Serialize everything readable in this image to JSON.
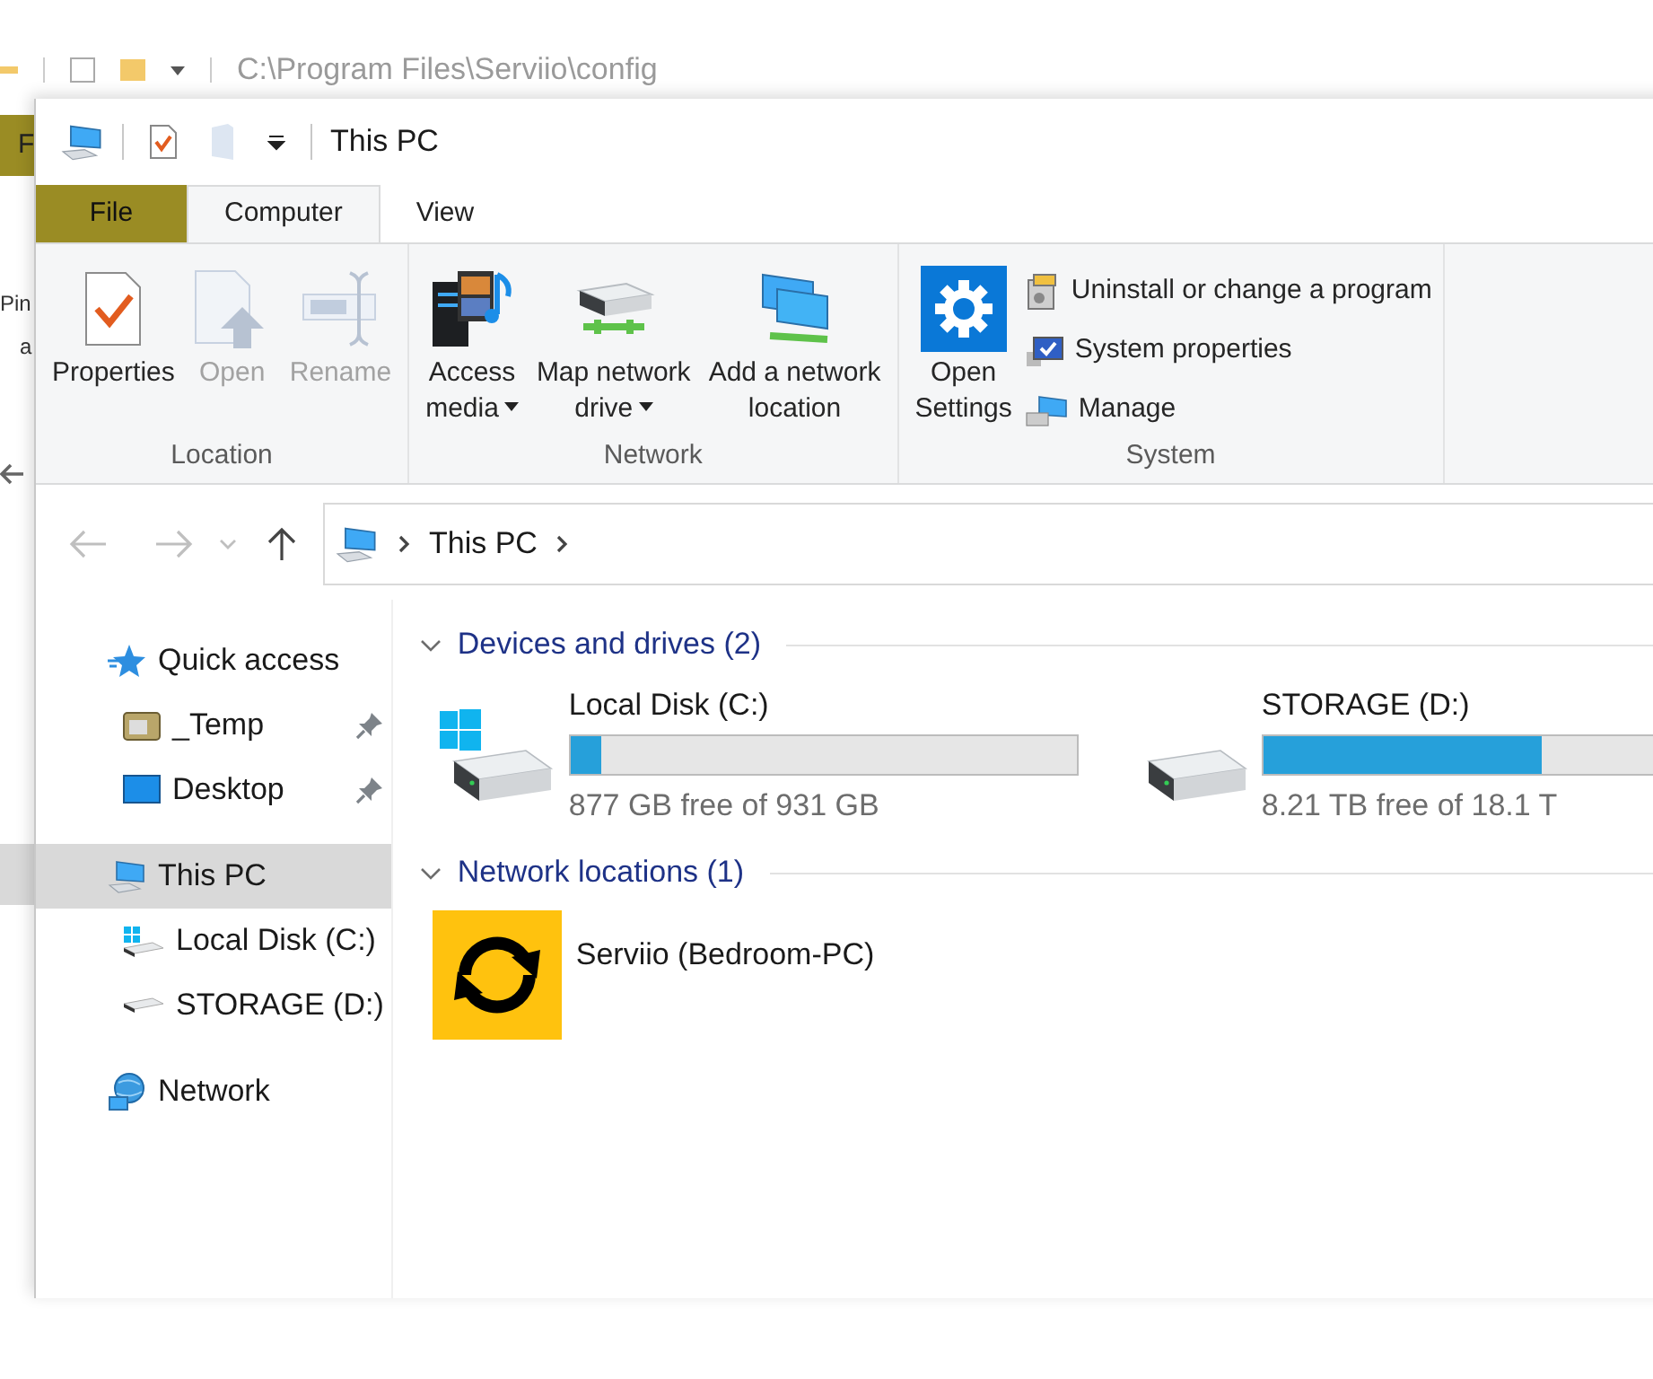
{
  "background_window": {
    "path": "C:\\Program Files\\Serviio\\config",
    "file_tab": "F",
    "labels": [
      "Pin",
      "a"
    ]
  },
  "window": {
    "title": "This PC"
  },
  "ribbon": {
    "file_menu": "File",
    "tabs": [
      {
        "label": "Computer",
        "selected": true
      },
      {
        "label": "View",
        "selected": false
      }
    ],
    "groups": [
      {
        "name": "Location",
        "buttons": [
          {
            "kind": "properties",
            "lines": [
              "Properties"
            ],
            "disabled": false,
            "has_menu": false
          },
          {
            "kind": "open",
            "lines": [
              "Open"
            ],
            "disabled": true,
            "has_menu": false
          },
          {
            "kind": "rename",
            "lines": [
              "Rename"
            ],
            "disabled": true,
            "has_menu": false
          }
        ]
      },
      {
        "name": "Network",
        "buttons": [
          {
            "kind": "media",
            "lines": [
              "Access",
              "media"
            ],
            "disabled": false,
            "has_menu": true
          },
          {
            "kind": "map_drive",
            "lines": [
              "Map network",
              "drive"
            ],
            "disabled": false,
            "has_menu": true
          },
          {
            "kind": "add_location",
            "lines": [
              "Add a network",
              "location"
            ],
            "disabled": false,
            "has_menu": false
          }
        ]
      },
      {
        "name": "System",
        "buttons": [
          {
            "kind": "settings",
            "lines": [
              "Open",
              "Settings"
            ],
            "disabled": false,
            "has_menu": false
          }
        ],
        "commands": [
          {
            "kind": "uninstall",
            "label": "Uninstall or change a program",
            "disabled": false
          },
          {
            "kind": "system_properties",
            "label": "System properties",
            "disabled": false
          },
          {
            "kind": "manage",
            "label": "Manage",
            "disabled": false
          }
        ]
      }
    ]
  },
  "address_bar": {
    "back_disabled": true,
    "forward_disabled": true,
    "breadcrumb": [
      "This PC"
    ]
  },
  "navigation": [
    {
      "label": "Quick access",
      "kind": "quick",
      "selected": false,
      "children": [
        {
          "label": "_Temp",
          "kind": "folder",
          "pinned": true,
          "selected": false
        },
        {
          "label": "Desktop",
          "kind": "desktop",
          "pinned": true,
          "selected": false
        }
      ]
    },
    {
      "label": "This PC",
      "kind": "pc",
      "selected": true,
      "children": [
        {
          "label": "Local Disk (C:)",
          "kind": "system_drive",
          "pinned": false,
          "selected": false
        },
        {
          "label": "STORAGE (D:)",
          "kind": "drive",
          "pinned": false,
          "selected": false
        }
      ]
    },
    {
      "label": "Network",
      "kind": "network",
      "selected": false
    }
  ],
  "sections": [
    {
      "title": "Devices and drives (2)",
      "expanded": true,
      "items": [
        {
          "kind": "system_drive",
          "name": "Local Disk (C:)",
          "level": 0.06,
          "free": "877 GB free of 931 GB"
        },
        {
          "kind": "drive",
          "name": "STORAGE (D:)",
          "level": 0.55,
          "free": "8.21 TB free of 18.1 T"
        }
      ]
    },
    {
      "title": "Network locations (1)",
      "expanded": true,
      "items": [
        {
          "kind": "media_server",
          "name": "Serviio (Bedroom-PC)"
        }
      ]
    }
  ]
}
